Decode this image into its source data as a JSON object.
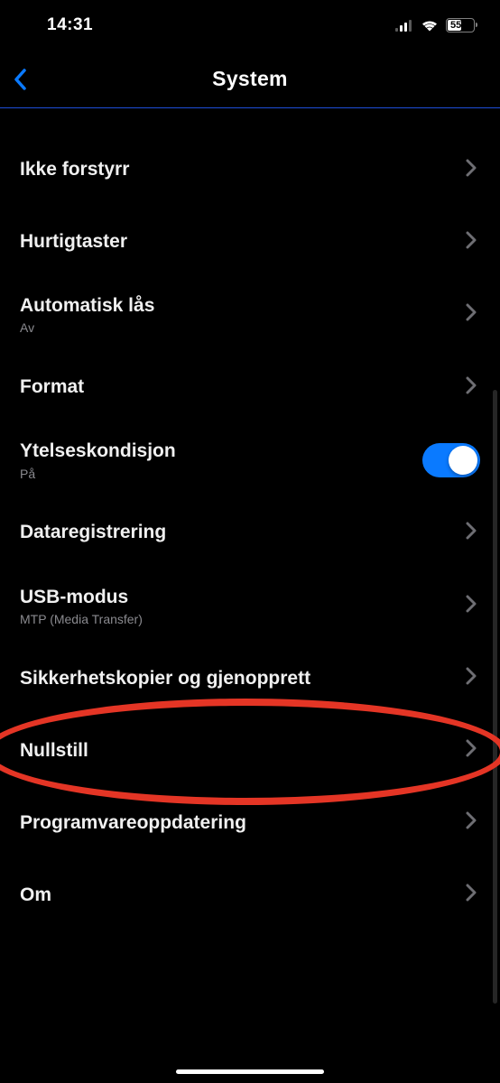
{
  "status": {
    "time": "14:31",
    "battery_text": "55"
  },
  "header": {
    "title": "System"
  },
  "items": [
    {
      "label": "Ikke forstyrr",
      "sublabel": null,
      "type": "nav"
    },
    {
      "label": "Hurtigtaster",
      "sublabel": null,
      "type": "nav"
    },
    {
      "label": "Automatisk lås",
      "sublabel": "Av",
      "type": "nav"
    },
    {
      "label": "Format",
      "sublabel": null,
      "type": "nav"
    },
    {
      "label": "Ytelseskondisjon",
      "sublabel": "På",
      "type": "toggle",
      "toggle_on": true
    },
    {
      "label": "Dataregistrering",
      "sublabel": null,
      "type": "nav"
    },
    {
      "label": "USB-modus",
      "sublabel": "MTP (Media Transfer)",
      "type": "nav"
    },
    {
      "label": "Sikkerhetskopier og gjenopprett",
      "sublabel": null,
      "type": "nav"
    },
    {
      "label": "Nullstill",
      "sublabel": null,
      "type": "nav"
    },
    {
      "label": "Programvareoppdatering",
      "sublabel": null,
      "type": "nav"
    },
    {
      "label": "Om",
      "sublabel": null,
      "type": "nav"
    }
  ]
}
